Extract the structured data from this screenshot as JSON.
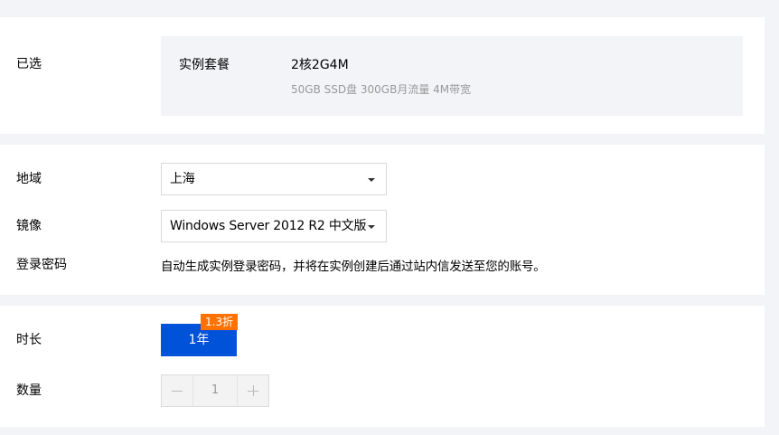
{
  "selected": {
    "label": "已选",
    "package_key": "实例套餐",
    "package_value": "2核2G4M",
    "package_specs": "50GB SSD盘 300GB月流量 4M带宽"
  },
  "config": {
    "region_label": "地域",
    "region_value": "上海",
    "image_label": "镜像",
    "image_value": "Windows Server 2012 R2 中文版",
    "password_label": "登录密码",
    "password_note": "自动生成实例登录密码，并将在实例创建后通过站内信发送至您的账号。"
  },
  "purchase": {
    "duration_label": "时长",
    "duration_value": "1年",
    "discount_badge": "1.3折",
    "quantity_label": "数量",
    "quantity_value": "1"
  },
  "colors": {
    "primary": "#0052d9",
    "badge": "#ff7200"
  }
}
